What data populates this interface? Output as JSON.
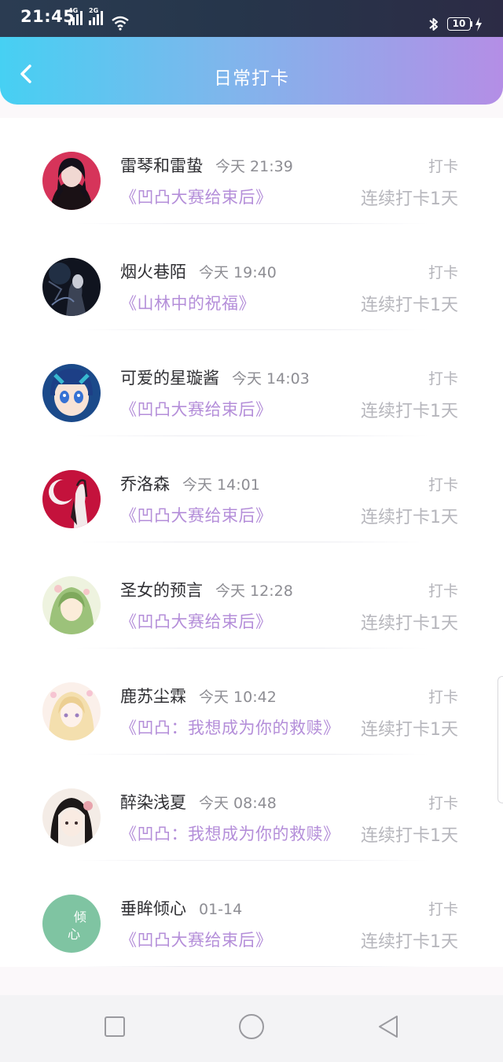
{
  "status_bar": {
    "time": "21:45",
    "network1": "4G",
    "network2": "2G",
    "battery": "10"
  },
  "header": {
    "title": "日常打卡"
  },
  "list": [
    {
      "name": "雷琴和雷蛰",
      "time": "今天 21:39",
      "label": "打卡",
      "work": "《凹凸大赛给束后》",
      "streak": "连续打卡1天",
      "avatar": "dark-girl"
    },
    {
      "name": "烟火巷陌",
      "time": "今天 19:40",
      "label": "打卡",
      "work": "《山林中的祝福》",
      "streak": "连续打卡1天",
      "avatar": "dark-figure"
    },
    {
      "name": "可爱的星璇酱",
      "time": "今天 14:03",
      "label": "打卡",
      "work": "《凹凸大赛给束后》",
      "streak": "连续打卡1天",
      "avatar": "anime-blue"
    },
    {
      "name": "乔洛森",
      "time": "今天 14:01",
      "label": "打卡",
      "work": "《凹凸大赛给束后》",
      "streak": "连续打卡1天",
      "avatar": "red-character"
    },
    {
      "name": "圣女的预言",
      "time": "今天 12:28",
      "label": "打卡",
      "work": "《凹凸大赛给束后》",
      "streak": "连续打卡1天",
      "avatar": "green-hair"
    },
    {
      "name": "鹿苏尘霖",
      "time": "今天 10:42",
      "label": "打卡",
      "work": "《凹凸：我想成为你的救赎》",
      "streak": "连续打卡1天",
      "avatar": "blonde-girl"
    },
    {
      "name": "醉染浅夏",
      "time": "今天 08:48",
      "label": "打卡",
      "work": "《凹凸：我想成为你的救赎》",
      "streak": "连续打卡1天",
      "avatar": "ink-girl"
    },
    {
      "name": "垂眸倾心",
      "time": "01-14",
      "label": "打卡",
      "work": "《凹凸大赛给束后》",
      "streak": "连续打卡1天",
      "avatar": "green-calligraphy",
      "avatar_text": [
        "倾",
        "心"
      ]
    }
  ],
  "colors": {
    "header_gradient": [
      "#46d0f3",
      "#b48ee6"
    ],
    "work_title": "#b48ed9"
  }
}
